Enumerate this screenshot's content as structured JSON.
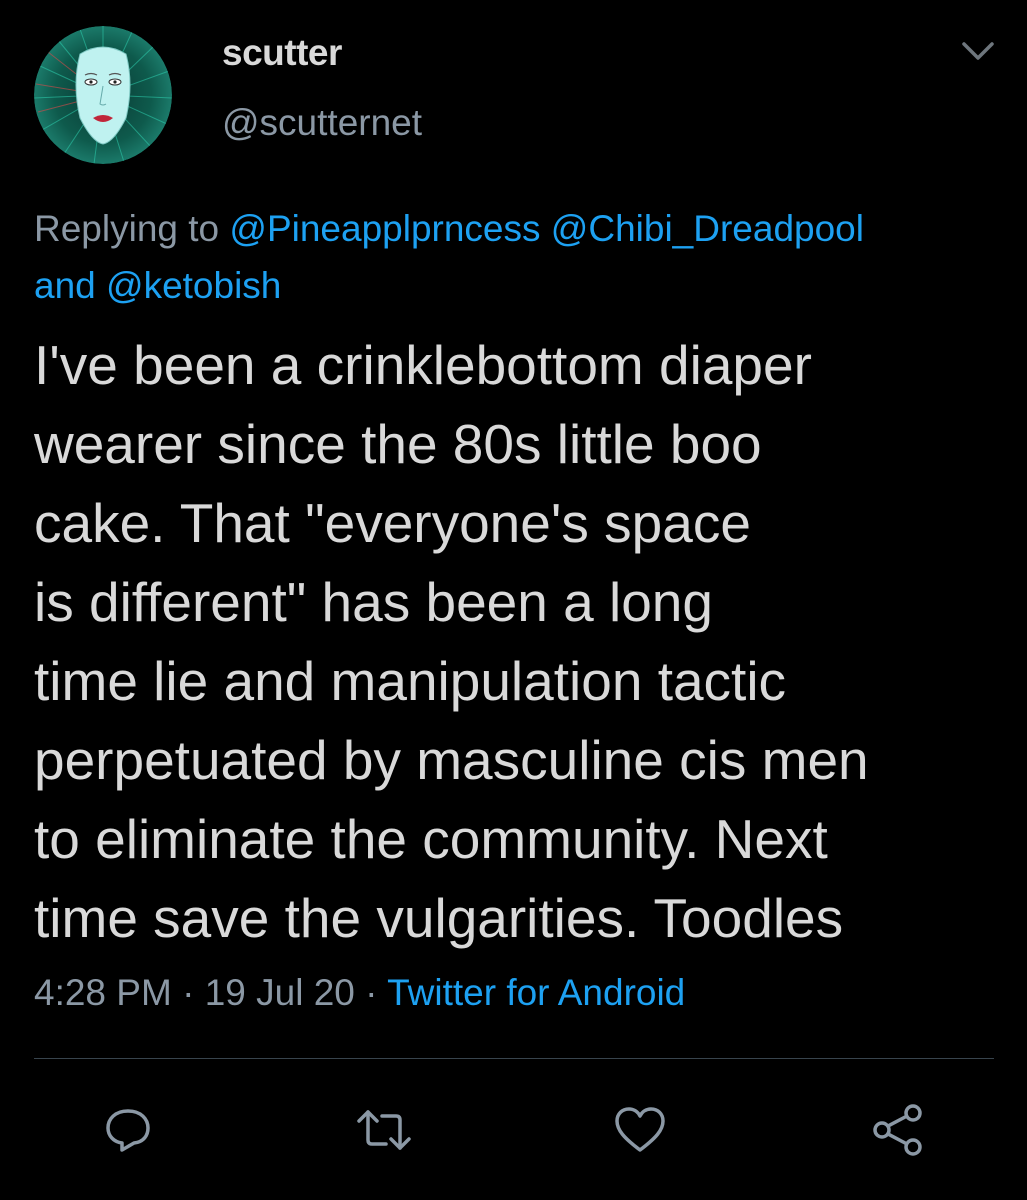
{
  "author": {
    "display_name": "scutter",
    "handle": "@scutternet"
  },
  "reply": {
    "prefix": "Replying to",
    "mention_1": "@Pineapplprncess",
    "mention_2": "@Chibi_Dreadpool",
    "conjunction": "and",
    "mention_3": "@ketobish"
  },
  "tweet": {
    "lines": [
      "I've been a crinklebottom diaper",
      "wearer since the 80s little boo",
      "cake. That \"everyone's space",
      "is different\" has been a long",
      "time lie and manipulation tactic",
      "perpetuated by masculine cis men",
      "to eliminate the community. Next",
      "time save the vulgarities. Toodles"
    ]
  },
  "meta": {
    "time": "4:28 PM",
    "separator_1": " · ",
    "date": "19 Jul 20",
    "separator_2": " · ",
    "source": "Twitter for Android"
  },
  "icons": {
    "reply": "reply-icon",
    "retweet": "retweet-icon",
    "like": "heart-icon",
    "share": "share-icon",
    "menu": "chevron-down-icon"
  },
  "colors": {
    "background": "#000000",
    "text": "#d9d9d9",
    "secondary": "#8b98a5",
    "link": "#1da1f2",
    "divider": "#38444d"
  }
}
